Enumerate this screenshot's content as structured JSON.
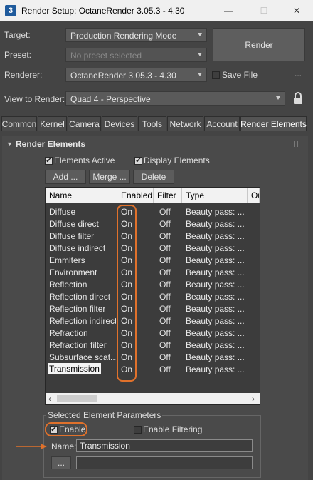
{
  "window": {
    "title": "Render Setup: OctaneRender 3.05.3 - 4.30",
    "app_icon_text": "3",
    "minimize_glyph": "—",
    "maximize_glyph": "☐",
    "close_glyph": "✕"
  },
  "setup": {
    "target_label": "Target:",
    "target_value": "Production Rendering Mode",
    "preset_label": "Preset:",
    "preset_placeholder": "No preset selected",
    "renderer_label": "Renderer:",
    "renderer_value": "OctaneRender 3.05.3 - 4.30",
    "save_file_label": "Save File",
    "save_file_checked": false,
    "more_glyph": "...",
    "view_label": "View to Render:",
    "view_value": "Quad 4 - Perspective",
    "render_button": "Render",
    "lock_icon": "lock-icon"
  },
  "tabs": [
    "Common",
    "Kernel",
    "Camera",
    "Devices",
    "Tools",
    "Network",
    "Account",
    "Render Elements"
  ],
  "active_tab": "Render Elements",
  "rollout": {
    "title": "Render Elements",
    "collapse_glyph": "▼",
    "elements_active_label": "Elements Active",
    "elements_active_checked": true,
    "display_elements_label": "Display Elements",
    "display_elements_checked": true,
    "add_button": "Add ...",
    "merge_button": "Merge ...",
    "delete_button": "Delete"
  },
  "table": {
    "columns": [
      "Name",
      "Enabled",
      "Filter",
      "Type",
      "Ou"
    ],
    "rows": [
      {
        "name": "Diffuse",
        "enabled": "On",
        "filter": "Off",
        "type": "Beauty pass: ..."
      },
      {
        "name": "Diffuse direct",
        "enabled": "On",
        "filter": "Off",
        "type": "Beauty pass: ..."
      },
      {
        "name": "Diffuse filter",
        "enabled": "On",
        "filter": "Off",
        "type": "Beauty pass: ..."
      },
      {
        "name": "Diffuse indirect",
        "enabled": "On",
        "filter": "Off",
        "type": "Beauty pass: ..."
      },
      {
        "name": "Emmiters",
        "enabled": "On",
        "filter": "Off",
        "type": "Beauty pass: ..."
      },
      {
        "name": "Environment",
        "enabled": "On",
        "filter": "Off",
        "type": "Beauty pass: ..."
      },
      {
        "name": "Reflection",
        "enabled": "On",
        "filter": "Off",
        "type": "Beauty pass: ..."
      },
      {
        "name": "Reflection direct",
        "enabled": "On",
        "filter": "Off",
        "type": "Beauty pass: ..."
      },
      {
        "name": "Reflection filter",
        "enabled": "On",
        "filter": "Off",
        "type": "Beauty pass: ..."
      },
      {
        "name": "Reflection indirect",
        "enabled": "On",
        "filter": "Off",
        "type": "Beauty pass: ..."
      },
      {
        "name": "Refraction",
        "enabled": "On",
        "filter": "Off",
        "type": "Beauty pass: ..."
      },
      {
        "name": "Refraction filter",
        "enabled": "On",
        "filter": "Off",
        "type": "Beauty pass: ..."
      },
      {
        "name": "Subsurface scat...",
        "enabled": "On",
        "filter": "Off",
        "type": "Beauty pass: ..."
      },
      {
        "name": "Transmission",
        "enabled": "On",
        "filter": "Off",
        "type": "Beauty pass: ..."
      }
    ],
    "selected_row": "Transmission",
    "scroll_left_glyph": "‹",
    "scroll_right_glyph": "›"
  },
  "params": {
    "group_title": "Selected Element Parameters",
    "enable_label": "Enable",
    "enable_checked": true,
    "enable_filtering_label": "Enable Filtering",
    "enable_filtering_checked": false,
    "name_label": "Name:",
    "name_value": "Transmission",
    "browse_button": "...",
    "path_value": ""
  },
  "colors": {
    "background": "#444444",
    "highlight": "#e0712b",
    "header_bg": "#f2f2f2"
  }
}
